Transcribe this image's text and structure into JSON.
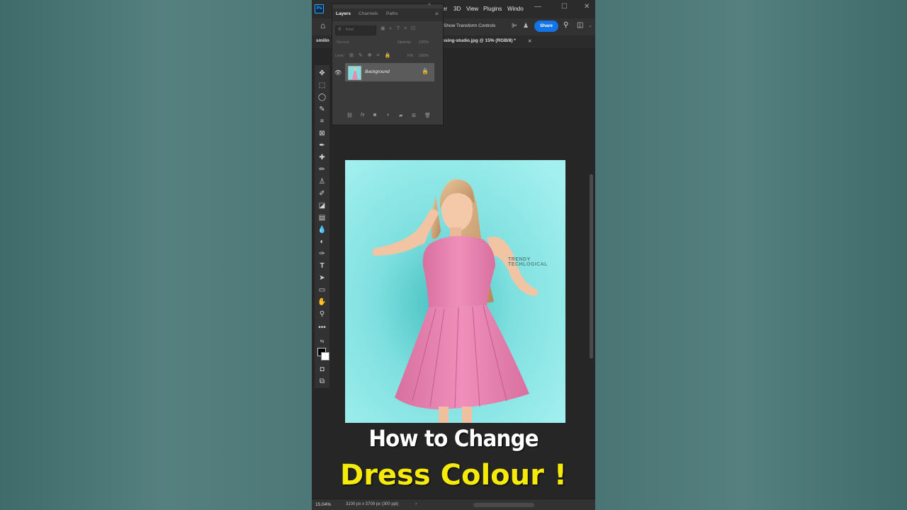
{
  "menubar": {
    "items": [
      "er",
      "3D",
      "View",
      "Plugins",
      "Windo"
    ]
  },
  "options_bar": {
    "transform_label": "Show Transform Controls",
    "share_label": "Share"
  },
  "tabs": {
    "left_tab": "smilin",
    "right_tab": "osing-studio.jpg @ 15% (RGB/8) *"
  },
  "layers_panel": {
    "tabs": [
      "Layers",
      "Channels",
      "Paths"
    ],
    "kind_placeholder": "Kind",
    "blend_mode": "Normal",
    "opacity_label": "Opacity:",
    "opacity_value": "100%",
    "lock_label": "Lock:",
    "fill_label": "Fill:",
    "fill_value": "100%",
    "layers": [
      {
        "name": "Background"
      }
    ]
  },
  "status": {
    "zoom": "15.04%",
    "dimensions": "3100 px x 3709 px (300 ppi)"
  },
  "watermark": "TRENDY TECHLOGICAL",
  "caption": {
    "line1": "How to Change",
    "line2": "Dress Colour !"
  },
  "colors": {
    "accent": "#1473e6",
    "caption_yellow": "#f5ea0a",
    "dress_pink": "#e889b3",
    "backdrop_cyan": "#8eeaea"
  }
}
